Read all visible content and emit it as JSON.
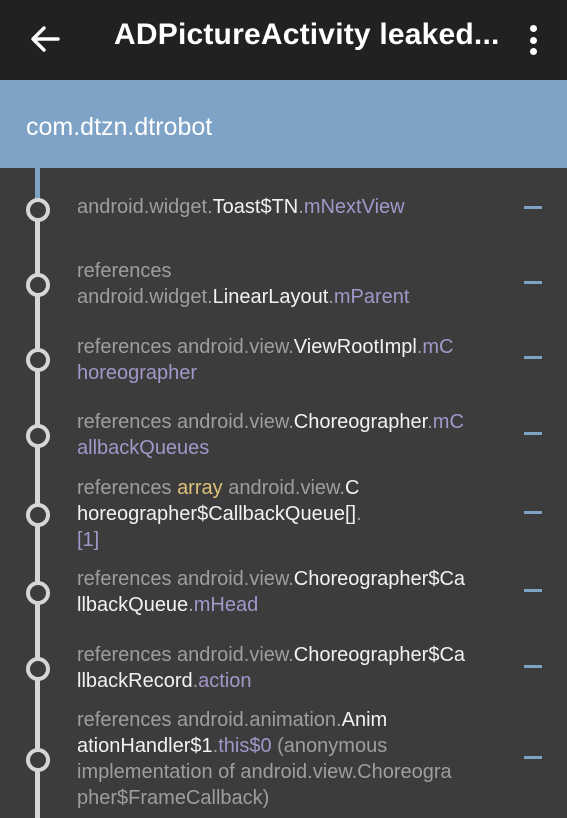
{
  "appbar": {
    "title": "ADPictureActivity leaked...",
    "back_icon": "arrow-back-icon",
    "menu_icon": "more-vert-icon"
  },
  "header": {
    "package": "com.dtzn.dtrobot"
  },
  "colors": {
    "appbar_bg": "#212121",
    "header_bg": "#7ea3c7",
    "content_bg": "#3c3c3c",
    "class_white": "#f2f2f2",
    "package_gray": "#9e9e9e",
    "field_purple": "#a396c9",
    "array_yellow": "#ddc17a"
  },
  "trace": [
    {
      "lines": [
        [
          [
            "g",
            "android.widget."
          ],
          [
            "w",
            "Toast$TN"
          ],
          [
            "g",
            "."
          ],
          [
            "p",
            "mNextView"
          ]
        ]
      ]
    },
    {
      "lines": [
        [
          [
            "g",
            "references"
          ]
        ],
        [
          [
            "g",
            "android.widget."
          ],
          [
            "w",
            "LinearLayout"
          ],
          [
            "g",
            "."
          ],
          [
            "p",
            "mParent"
          ]
        ]
      ]
    },
    {
      "lines": [
        [
          [
            "g",
            "references android.view."
          ],
          [
            "w",
            "ViewRootImpl"
          ],
          [
            "g",
            "."
          ],
          [
            "p",
            "mC"
          ]
        ],
        [
          [
            "p",
            "horeographer"
          ]
        ]
      ]
    },
    {
      "lines": [
        [
          [
            "g",
            "references android.view."
          ],
          [
            "w",
            "Choreographer"
          ],
          [
            "g",
            "."
          ],
          [
            "p",
            "mC"
          ]
        ],
        [
          [
            "p",
            "allbackQueues"
          ]
        ]
      ]
    },
    {
      "lines": [
        [
          [
            "g",
            "references "
          ],
          [
            "y",
            "array"
          ],
          [
            "g",
            " android.view."
          ],
          [
            "w",
            "C"
          ]
        ],
        [
          [
            "w",
            "horeographer$CallbackQueue[]"
          ],
          [
            "g",
            "."
          ]
        ],
        [
          [
            "p",
            "[1]"
          ]
        ]
      ]
    },
    {
      "lines": [
        [
          [
            "g",
            "references android.view."
          ],
          [
            "w",
            "Choreographer$Ca"
          ]
        ],
        [
          [
            "w",
            "llbackQueue"
          ],
          [
            "g",
            "."
          ],
          [
            "p",
            "mHead"
          ]
        ]
      ]
    },
    {
      "lines": [
        [
          [
            "g",
            "references android.view."
          ],
          [
            "w",
            "Choreographer$Ca"
          ]
        ],
        [
          [
            "w",
            "llbackRecord"
          ],
          [
            "g",
            "."
          ],
          [
            "p",
            "action"
          ]
        ]
      ]
    },
    {
      "lines": [
        [
          [
            "g",
            "references android.animation."
          ],
          [
            "w",
            "Anim"
          ]
        ],
        [
          [
            "w",
            "ationHandler$1"
          ],
          [
            "g",
            "."
          ],
          [
            "p",
            "this$0"
          ],
          [
            "g",
            " (anonymous"
          ]
        ],
        [
          [
            "g",
            "implementation of android.view.Choreogra"
          ]
        ],
        [
          [
            "g",
            "pher$FrameCallback)"
          ]
        ]
      ]
    }
  ]
}
